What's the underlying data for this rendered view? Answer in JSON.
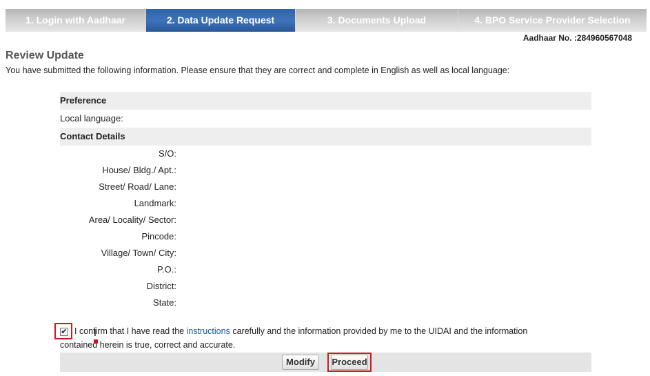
{
  "steps": [
    {
      "label": "1. Login with Aadhaar",
      "active": false
    },
    {
      "label": "2. Data Update Request",
      "active": true
    },
    {
      "label": "3. Documents Upload",
      "active": false
    },
    {
      "label": "4. BPO Service Provider Selection",
      "active": false
    }
  ],
  "aadhaar": {
    "text": "Aadhaar No. :284960567048"
  },
  "review": {
    "title": "Review Update",
    "intro": "You have submitted the following information. Please ensure that they are correct and complete in English as well as local language:",
    "preference": {
      "header": "Preference",
      "local_language_label": "Local language:"
    },
    "contact": {
      "header": "Contact Details",
      "fields": [
        {
          "label": "S/O:",
          "value": ""
        },
        {
          "label": "House/ Bldg./ Apt.:",
          "value": ""
        },
        {
          "label": "Street/ Road/ Lane:",
          "value": ""
        },
        {
          "label": "Landmark:",
          "value": ""
        },
        {
          "label": "Area/ Locality/ Sector:",
          "value": ""
        },
        {
          "label": "Pincode:",
          "value": ""
        },
        {
          "label": "Village/ Town/ City:",
          "value": ""
        },
        {
          "label": "P.O.:",
          "value": ""
        },
        {
          "label": "District:",
          "value": ""
        },
        {
          "label": "State:",
          "value": ""
        }
      ]
    }
  },
  "confirm": {
    "checked": true,
    "checkmark": "✔",
    "text_before": "I confirm that I have read the",
    "link_text": "instructions",
    "text_after": "carefully and the information provided by me to the UIDAI and the information",
    "line2": "contained herein is true, correct and accurate."
  },
  "actions": {
    "modify_label": "Modify",
    "proceed_label": "Proceed"
  },
  "colors": {
    "active_step": "#3e73bb",
    "highlight": "#c81e1e",
    "link": "#1a5aa6"
  }
}
